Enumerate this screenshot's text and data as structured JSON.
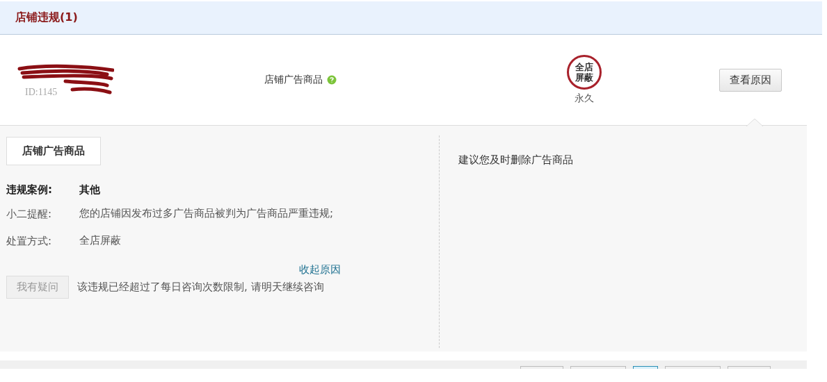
{
  "header": {
    "title": "店铺违规(1)"
  },
  "violation": {
    "shop_id": "ID:1145",
    "type": "店铺广告商品",
    "status_ok": true,
    "penalty_stamp": "全店屏蔽",
    "duration": "永久",
    "action_button": "查看原因"
  },
  "detail": {
    "tab": "店铺广告商品",
    "fields": [
      {
        "kind": "bold",
        "label": "违规案例:",
        "value": "其他"
      },
      {
        "kind": "plain",
        "label": "小二提醒:",
        "value": "您的店铺因发布过多广告商品被判为广告商品严重违规;"
      },
      {
        "kind": "plain",
        "label": "处置方式:",
        "value": "全店屏蔽"
      }
    ],
    "collapse_link": "收起原因",
    "appeal_button": {
      "label": "我有疑问",
      "disabled": true
    },
    "appeal_note": "该违规已经超过了每日咨询次数限制, 请明天继续咨询",
    "suggestion": "建议您及时删除广告商品"
  },
  "pager": [
    {
      "selected": false
    },
    {
      "selected": false
    },
    {
      "selected": true
    },
    {
      "selected": false
    },
    {
      "selected": false
    }
  ]
}
